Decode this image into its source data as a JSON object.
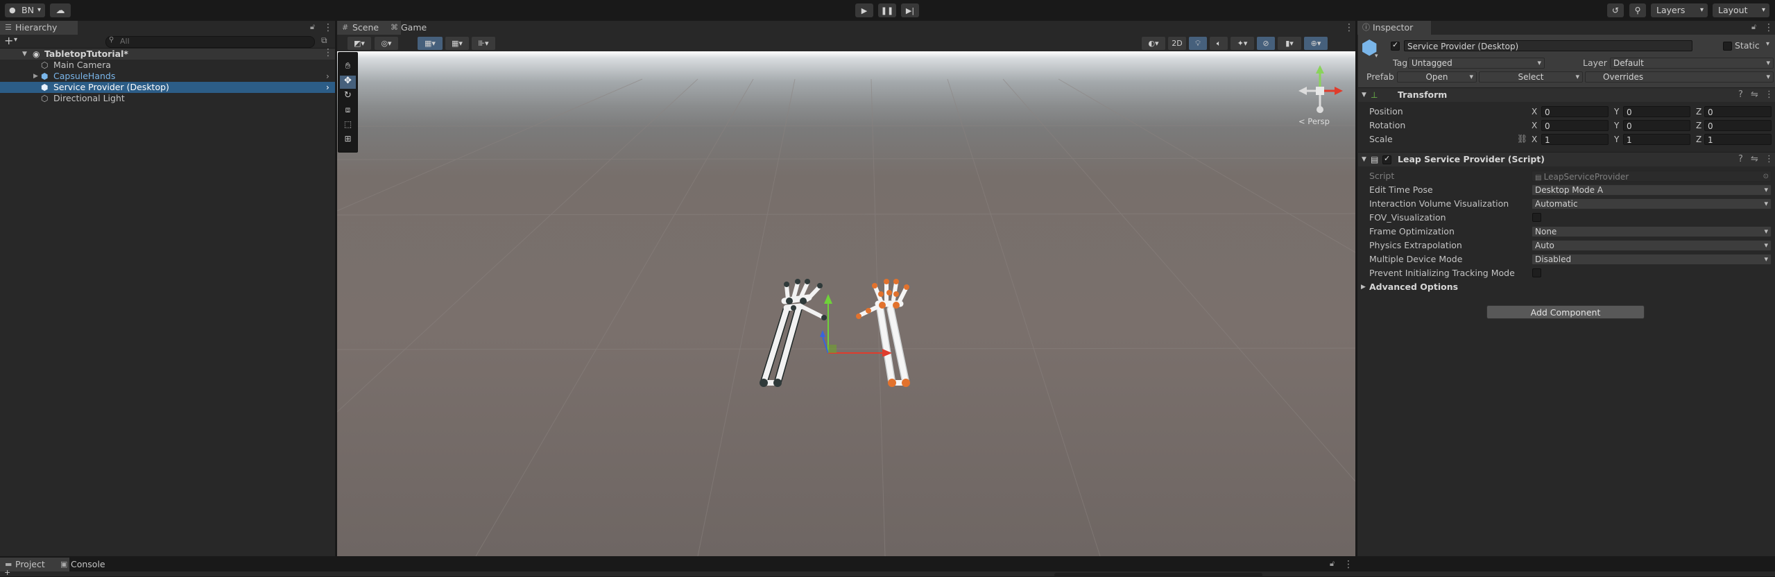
{
  "toolbar": {
    "account": "BN",
    "layers": "Layers",
    "layout": "Layout",
    "play_icon": "play-icon",
    "pause_icon": "pause-icon",
    "step_icon": "step-icon"
  },
  "hierarchy": {
    "tab": "Hierarchy",
    "search_placeholder": "All",
    "scene_name": "TabletopTutorial*",
    "items": [
      {
        "label": "Main Camera"
      },
      {
        "label": "CapsuleHands"
      },
      {
        "label": "Service Provider (Desktop)"
      },
      {
        "label": "Directional Light"
      }
    ]
  },
  "scene_view": {
    "tabs": [
      {
        "label": "Scene"
      },
      {
        "label": "Game"
      }
    ],
    "toggle_2d": "2D",
    "persp_label": "< Persp"
  },
  "inspector": {
    "tab": "Inspector",
    "object_name": "Service Provider (Desktop)",
    "static_label": "Static",
    "tag_label": "Tag",
    "tag_value": "Untagged",
    "layer_label": "Layer",
    "layer_value": "Default",
    "prefab_label": "Prefab",
    "prefab_open": "Open",
    "prefab_select": "Select",
    "prefab_overrides": "Overrides",
    "transform": {
      "title": "Transform",
      "position_label": "Position",
      "rotation_label": "Rotation",
      "scale_label": "Scale",
      "position": {
        "x": "0",
        "y": "0",
        "z": "0"
      },
      "rotation": {
        "x": "0",
        "y": "0",
        "z": "0"
      },
      "scale": {
        "x": "1",
        "y": "1",
        "z": "1"
      },
      "axes": {
        "x": "X",
        "y": "Y",
        "z": "Z"
      }
    },
    "leap": {
      "title": "Leap Service Provider (Script)",
      "script_label": "Script",
      "script_value": "LeapServiceProvider",
      "edit_time_pose_label": "Edit Time Pose",
      "edit_time_pose_value": "Desktop Mode A",
      "interaction_volume_label": "Interaction Volume Visualization",
      "interaction_volume_value": "Automatic",
      "fov_label": "FOV_Visualization",
      "frame_opt_label": "Frame Optimization",
      "frame_opt_value": "None",
      "physics_extrap_label": "Physics Extrapolation",
      "physics_extrap_value": "Auto",
      "multi_device_label": "Multiple Device Mode",
      "multi_device_value": "Disabled",
      "prevent_init_label": "Prevent Initializing Tracking Mode",
      "advanced_label": "Advanced Options"
    },
    "add_component": "Add Component"
  },
  "bottom": {
    "tabs": [
      {
        "label": "Project"
      },
      {
        "label": "Console"
      }
    ]
  },
  "colors": {
    "selection": "#2c5d87",
    "panel": "#282828",
    "toolbar": "#191919",
    "right_hand_orange": "#e2722d",
    "left_hand_dark": "#2f3a3a"
  }
}
